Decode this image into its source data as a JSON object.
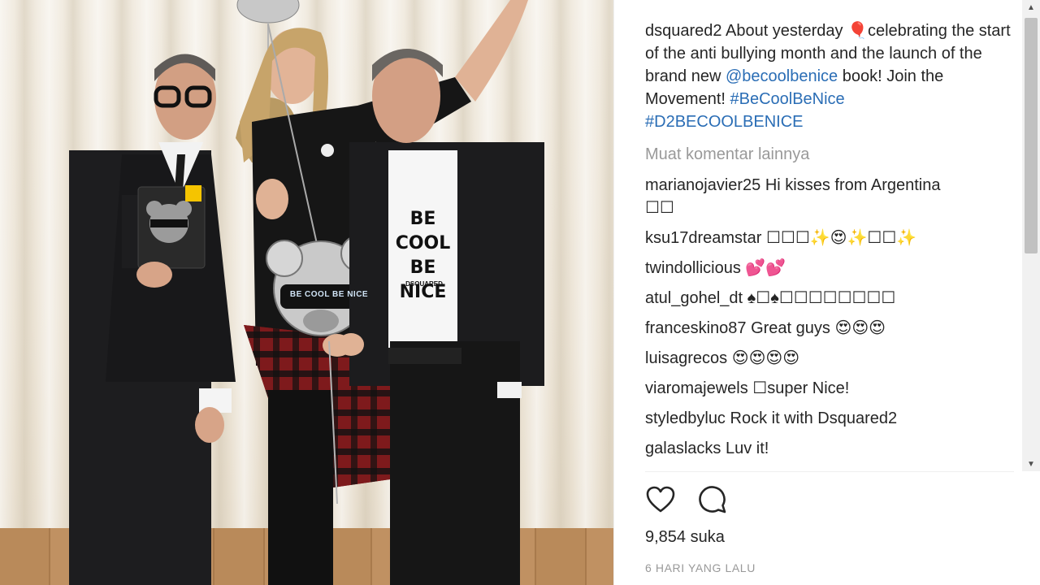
{
  "post": {
    "caption": {
      "user": "dsquared2",
      "text_part1": " About yesterday ",
      "balloon": "🎈",
      "text_part2": "celebrating the start of the anti bullying month and the launch of the brand new ",
      "mention": "@becoolbenice",
      "text_part3": " book! Join the Movement! ",
      "hashtag1": "#BeCoolBeNice",
      "hashtag2": "#D2BECOOLBENICE"
    },
    "load_more": "Muat komentar lainnya",
    "comments": [
      {
        "user": "marianojavier25",
        "text": "Hi kisses from Argentina",
        "text2": "☐☐"
      },
      {
        "user": "ksu17dreamstar",
        "text": "☐☐☐✨😍✨☐☐✨"
      },
      {
        "user": "twindollicious",
        "text": "💕💕"
      },
      {
        "user": "atul_gohel_dt",
        "text": "♠☐♠☐☐☐☐☐☐☐☐"
      },
      {
        "user": "franceskino87",
        "text": "Great guys 😍😍😍"
      },
      {
        "user": "luisagrecos",
        "text": "😍😍😍😍"
      },
      {
        "user": "viaromajewels",
        "text": "☐super Nice!"
      },
      {
        "user": "styledbyluc",
        "text": "Rock it with Dsquared2"
      },
      {
        "user": "galaslacks",
        "text": "Luv it!"
      }
    ],
    "likes": "9,854 suka",
    "time_ago": "6 HARI YANG LALU"
  },
  "photo": {
    "book_text": "BE COOL BE NICE",
    "shirt_text": "BE COOL BE NICE",
    "shirt_brand": "DSQUARED"
  },
  "icons": {
    "like": "heart-icon",
    "comment": "comment-bubble-icon"
  }
}
